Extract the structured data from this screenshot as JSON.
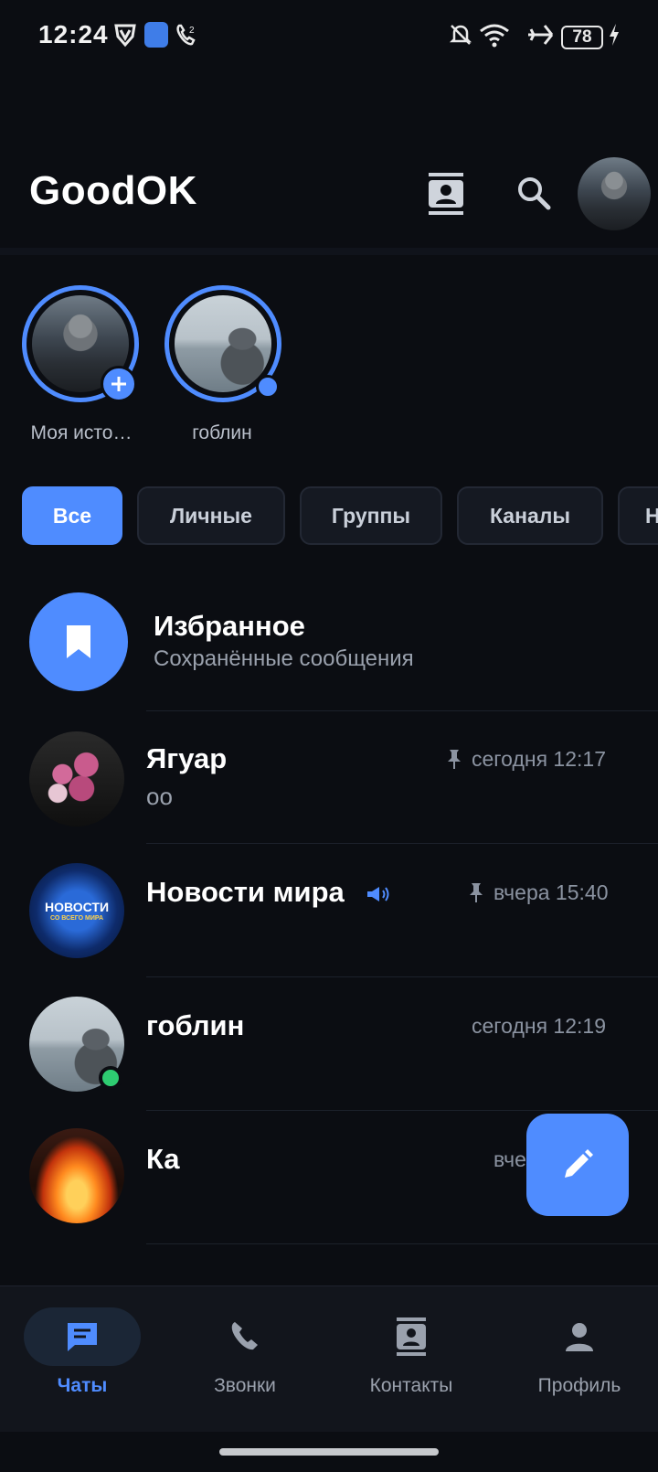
{
  "status_bar": {
    "time": "12:24",
    "battery": "78",
    "icons": [
      "vpn-shield-icon",
      "app-notification-icon",
      "wifi-call-icon",
      "bell-off-icon",
      "wifi-icon",
      "airplane-icon",
      "battery-icon",
      "charging-icon"
    ]
  },
  "header": {
    "title": "GoodOK",
    "icons": [
      "contacts-book-icon",
      "search-icon",
      "profile-avatar"
    ]
  },
  "stories": [
    {
      "label": "Моя исто…"
    },
    {
      "label": "гоблин"
    }
  ],
  "filters": {
    "tabs": [
      "Все",
      "Личные",
      "Группы",
      "Каналы",
      "Н"
    ],
    "active": "Все"
  },
  "chats": [
    {
      "name": "Избранное",
      "subtitle": "Сохранённые сообщения"
    },
    {
      "name": "Ягуар",
      "subtitle": "оо",
      "time": "сегодня 12:17",
      "pinned": true
    },
    {
      "name": "Новости мира",
      "time": "вчера 15:40",
      "pinned": true,
      "channel": true,
      "avatar_text_1": "НОВОСТИ",
      "avatar_text_2": "СО ВСЕГО МИРА"
    },
    {
      "name": "гоблин",
      "time": "сегодня 12:19",
      "online": true
    },
    {
      "name": "Ка",
      "time": "вче"
    }
  ],
  "nav": {
    "items": [
      {
        "label": "Чаты",
        "icon": "chat-icon"
      },
      {
        "label": "Звонки",
        "icon": "phone-icon"
      },
      {
        "label": "Контакты",
        "icon": "contacts-icon"
      },
      {
        "label": "Профиль",
        "icon": "person-icon"
      }
    ],
    "active": "Чаты"
  },
  "colors": {
    "background": "#0b0d12",
    "accent": "#4f8cff",
    "online": "#2ecc71"
  }
}
